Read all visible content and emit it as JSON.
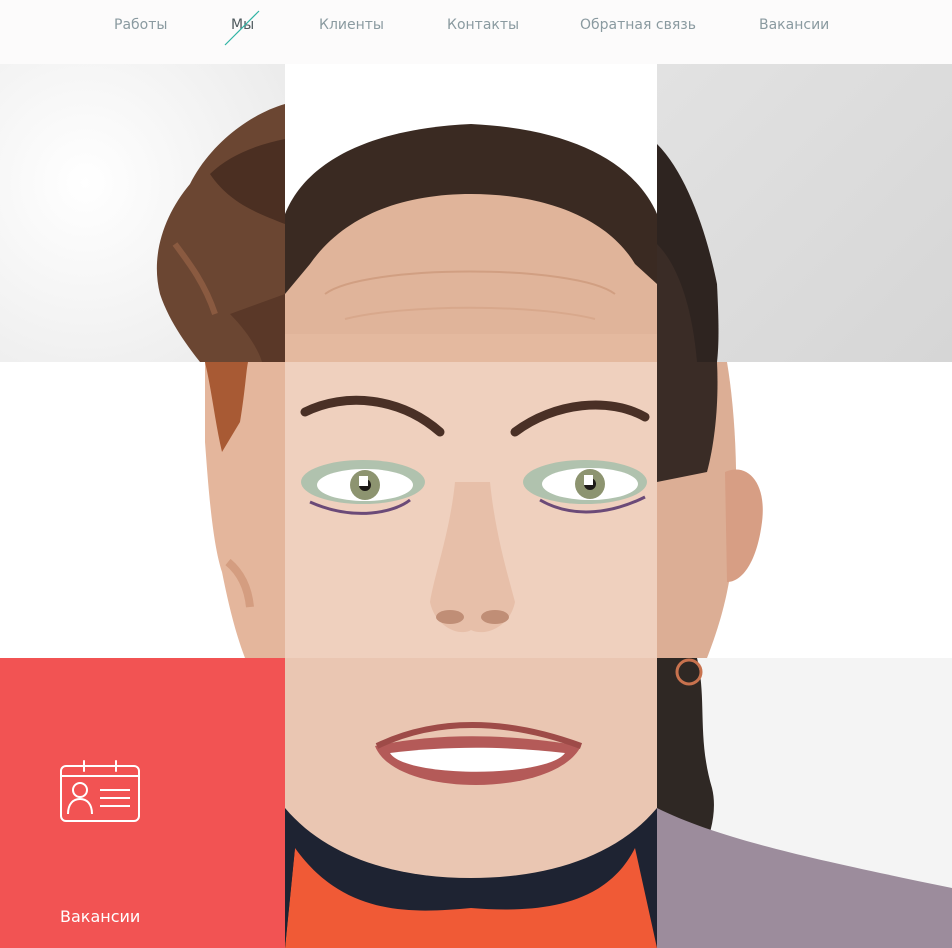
{
  "nav": {
    "items": [
      {
        "label": "Работы",
        "active": false
      },
      {
        "label": "Мы",
        "active": true
      },
      {
        "label": "Клиенты",
        "active": false
      },
      {
        "label": "Контакты",
        "active": false
      },
      {
        "label": "Обратная связь",
        "active": false
      },
      {
        "label": "Вакансии",
        "active": false
      }
    ]
  },
  "vacancies_card": {
    "label": "Вакансии",
    "icon": "id-card-icon"
  },
  "colors": {
    "accent": "#f25353",
    "nav_text": "#8a9aa0",
    "nav_active_slash": "#2fb3a4",
    "nav_bg": "#fcfbfb"
  }
}
